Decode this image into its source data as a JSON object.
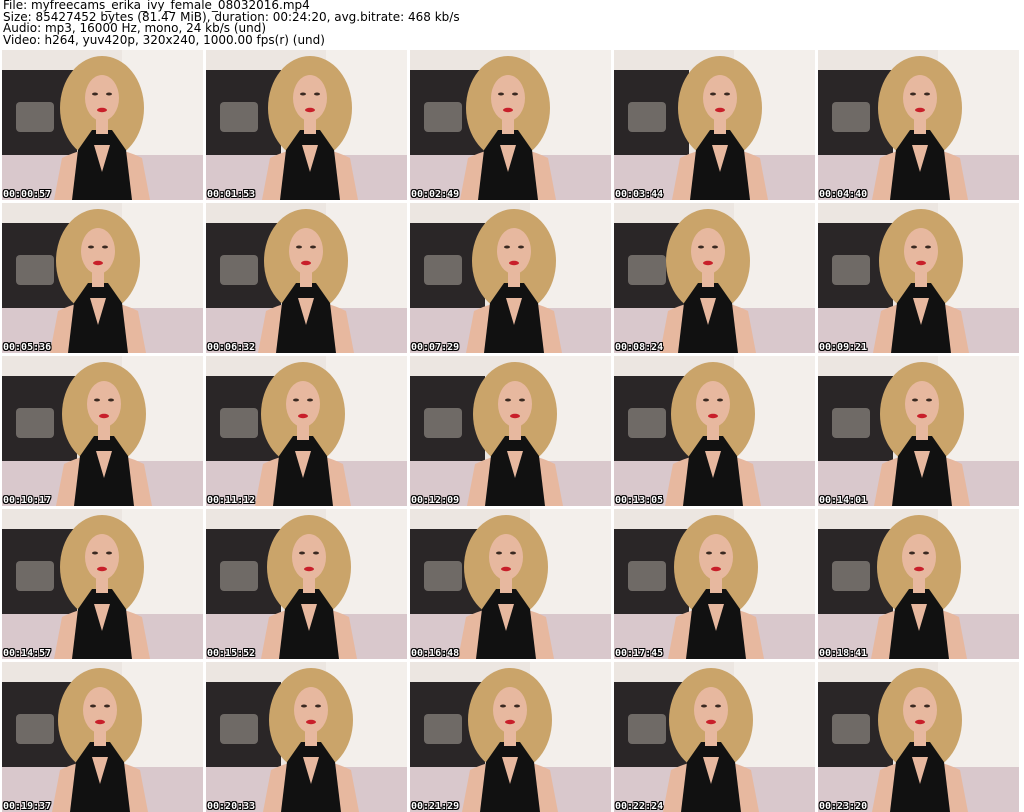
{
  "header": {
    "file": "File: myfreecams_erika_ivy_female_08032016.mp4",
    "size": "Size: 85427452 bytes (81.47 MiB), duration: 00:24:20, avg.bitrate: 468 kb/s",
    "audio": "Audio: mp3, 16000 Hz, mono, 24 kb/s (und)",
    "video": "Video: h264, yuv420p, 320x240, 1000.00 fps(r) (und)"
  },
  "thumbnails": [
    {
      "time": "00:00:57"
    },
    {
      "time": "00:01:53"
    },
    {
      "time": "00:02:49"
    },
    {
      "time": "00:03:44"
    },
    {
      "time": "00:04:40"
    },
    {
      "time": "00:05:36"
    },
    {
      "time": "00:06:32"
    },
    {
      "time": "00:07:29"
    },
    {
      "time": "00:08:24"
    },
    {
      "time": "00:09:21"
    },
    {
      "time": "00:10:17"
    },
    {
      "time": "00:11:12"
    },
    {
      "time": "00:12:09"
    },
    {
      "time": "00:13:05"
    },
    {
      "time": "00:14:01"
    },
    {
      "time": "00:14:57"
    },
    {
      "time": "00:15:52"
    },
    {
      "time": "00:16:48"
    },
    {
      "time": "00:17:45"
    },
    {
      "time": "00:18:41"
    },
    {
      "time": "00:19:37"
    },
    {
      "time": "00:20:33"
    },
    {
      "time": "00:21:29"
    },
    {
      "time": "00:22:24"
    },
    {
      "time": "00:23:20"
    }
  ],
  "colors": {
    "wall": "#ece6e1",
    "headboard": "#2a2627",
    "bedsheet": "#d9c8cc",
    "hair": "#caa46a",
    "skin": "#e7b89f",
    "dress": "#111111",
    "lips": "#c81f2a"
  }
}
